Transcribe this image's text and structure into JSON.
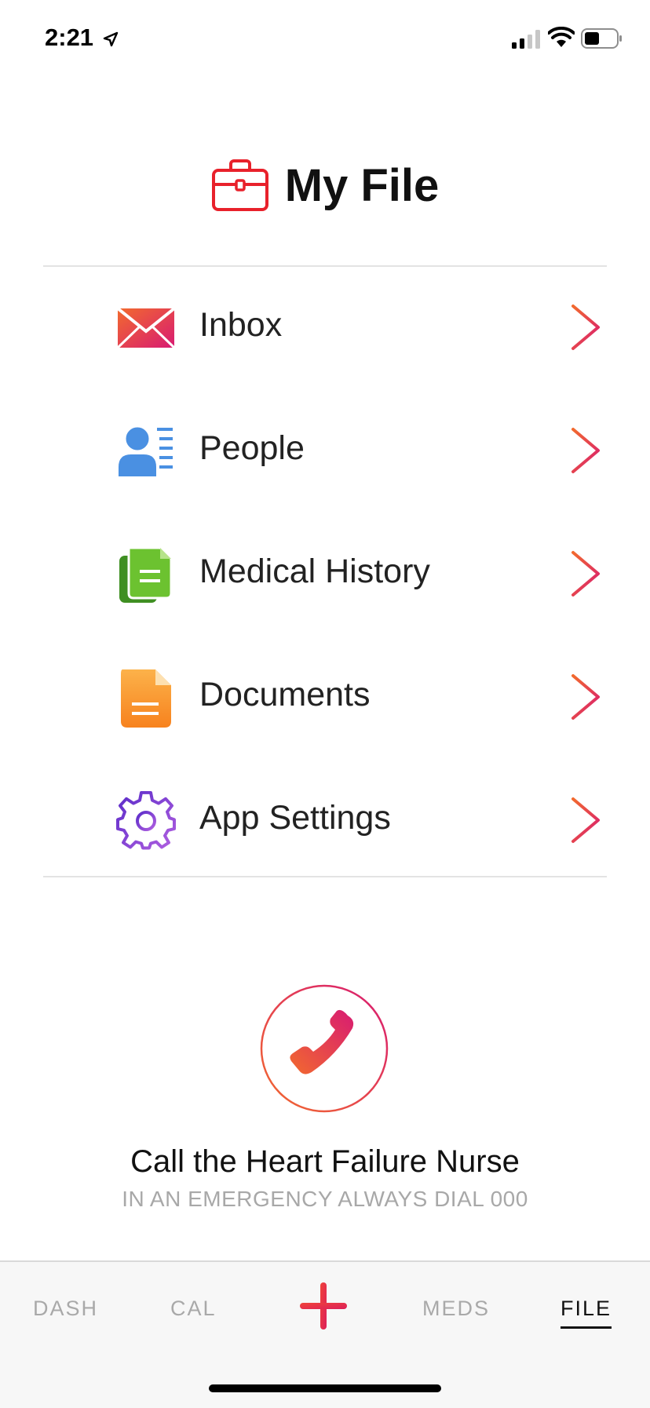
{
  "status_bar": {
    "time": "2:21"
  },
  "header": {
    "title": "My File"
  },
  "menu": {
    "items": [
      {
        "label": "Inbox",
        "icon": "envelope-icon"
      },
      {
        "label": "People",
        "icon": "people-icon"
      },
      {
        "label": "Medical History",
        "icon": "medical-history-icon"
      },
      {
        "label": "Documents",
        "icon": "document-icon"
      },
      {
        "label": "App Settings",
        "icon": "gear-icon"
      }
    ]
  },
  "call": {
    "title": "Call the Heart Failure Nurse",
    "subtitle": "IN AN EMERGENCY ALWAYS DIAL 000"
  },
  "tabs": [
    {
      "label": "DASH",
      "active": false
    },
    {
      "label": "CAL",
      "active": false
    },
    {
      "label": "MEDS",
      "active": false
    },
    {
      "label": "FILE",
      "active": true
    }
  ],
  "colors": {
    "accent_red": "#e8212b",
    "gradient_start": "#f26a2e",
    "gradient_end": "#d81b72",
    "people_blue": "#4a90e2",
    "history_green": "#5cb32e",
    "documents_orange": "#f7931e",
    "settings_purple": "#7e3fd1"
  }
}
